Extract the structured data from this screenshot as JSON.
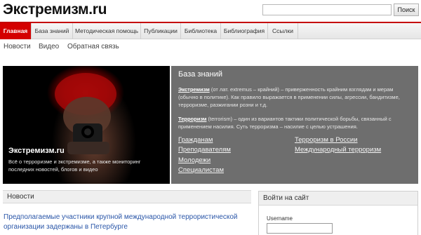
{
  "header": {
    "site_title": "Экстремизм.ru",
    "search_placeholder": "",
    "search_button": "Поиск"
  },
  "nav": {
    "items": [
      "Главная",
      "База знаний",
      "Методическая помощь",
      "Публикации",
      "Библиотека",
      "Библиография",
      "Ссылки"
    ],
    "active_index": 0
  },
  "subnav": {
    "items": [
      "Новости",
      "Видео",
      "Обратная связь"
    ]
  },
  "hero": {
    "title": "Экстремизм.ru",
    "text": "Всё о терроризме и экстремизме, а также мониторинг последних новостей, блогов и видео"
  },
  "knowledge": {
    "heading": "База знаний",
    "term1": "Экстремизм",
    "def1": " (от лат. extremus – крайний) – приверженность крайним взглядам и мерам (обычно в политике). Как правило выражается в применении силы, агрессии, бандитизме, терроризме, разжигании розни и т.д.",
    "term2": "Терроризм",
    "def2": " (terrorism) – один из вариантов тактики политической борьбы, связанный с применением насилия. Суть терроризма – насилие с целью устрашения.",
    "links_left": [
      "Гражданам",
      "Преподавателям",
      "Молодежи",
      "Специалистам"
    ],
    "links_right": [
      "Терроризм в России",
      "Международный терроризм"
    ]
  },
  "news": {
    "heading": "Новости",
    "first_item": "Предполагаемые участники крупной международной террористической организации задержаны в Петербурге"
  },
  "login": {
    "heading": "Войти на сайт",
    "username_label": "Username"
  },
  "colors": {
    "accent": "#d40000",
    "link": "#2a56a8",
    "panel": "#6e6e6e"
  }
}
